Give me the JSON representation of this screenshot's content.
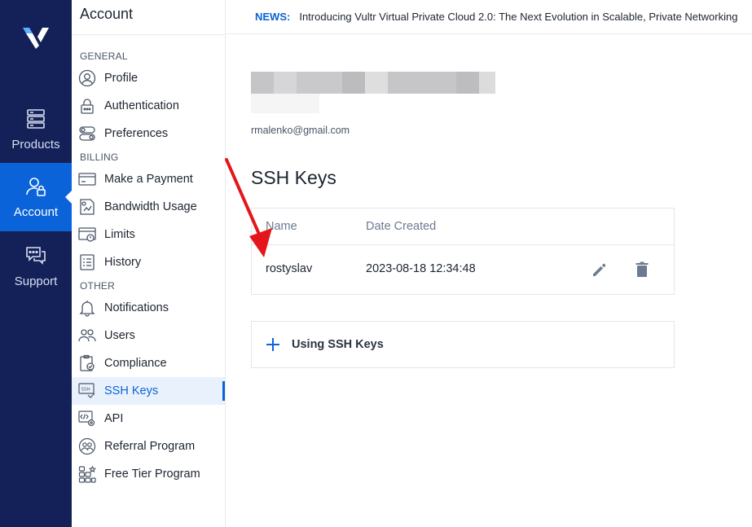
{
  "rail": {
    "items": [
      {
        "label": "Products",
        "icon": "server-icon"
      },
      {
        "label": "Account",
        "icon": "user-lock-icon",
        "active": true
      },
      {
        "label": "Support",
        "icon": "chat-icon"
      }
    ]
  },
  "subnav": {
    "title": "Account",
    "sections": [
      {
        "label": "GENERAL",
        "items": [
          "Profile",
          "Authentication",
          "Preferences"
        ]
      },
      {
        "label": "BILLING",
        "items": [
          "Make a Payment",
          "Bandwidth Usage",
          "Limits",
          "History"
        ]
      },
      {
        "label": "OTHER",
        "items": [
          "Notifications",
          "Users",
          "Compliance",
          "SSH Keys",
          "API",
          "Referral Program",
          "Free Tier Program"
        ]
      }
    ],
    "active_item": "SSH Keys"
  },
  "news": {
    "tag": "NEWS:",
    "text": "Introducing Vultr Virtual Private Cloud 2.0: The Next Evolution in Scalable, Private Networking"
  },
  "profile": {
    "email": "rmalenko@gmail.com"
  },
  "ssh": {
    "heading": "SSH Keys",
    "columns": [
      "Name",
      "Date Created"
    ],
    "rows": [
      {
        "name": "rostyslav",
        "date": "2023-08-18 12:34:48"
      }
    ],
    "accordion_label": "Using SSH Keys"
  },
  "colors": {
    "rail_bg": "#142158",
    "accent": "#0b63d9",
    "annotation_arrow": "#e4161a"
  }
}
